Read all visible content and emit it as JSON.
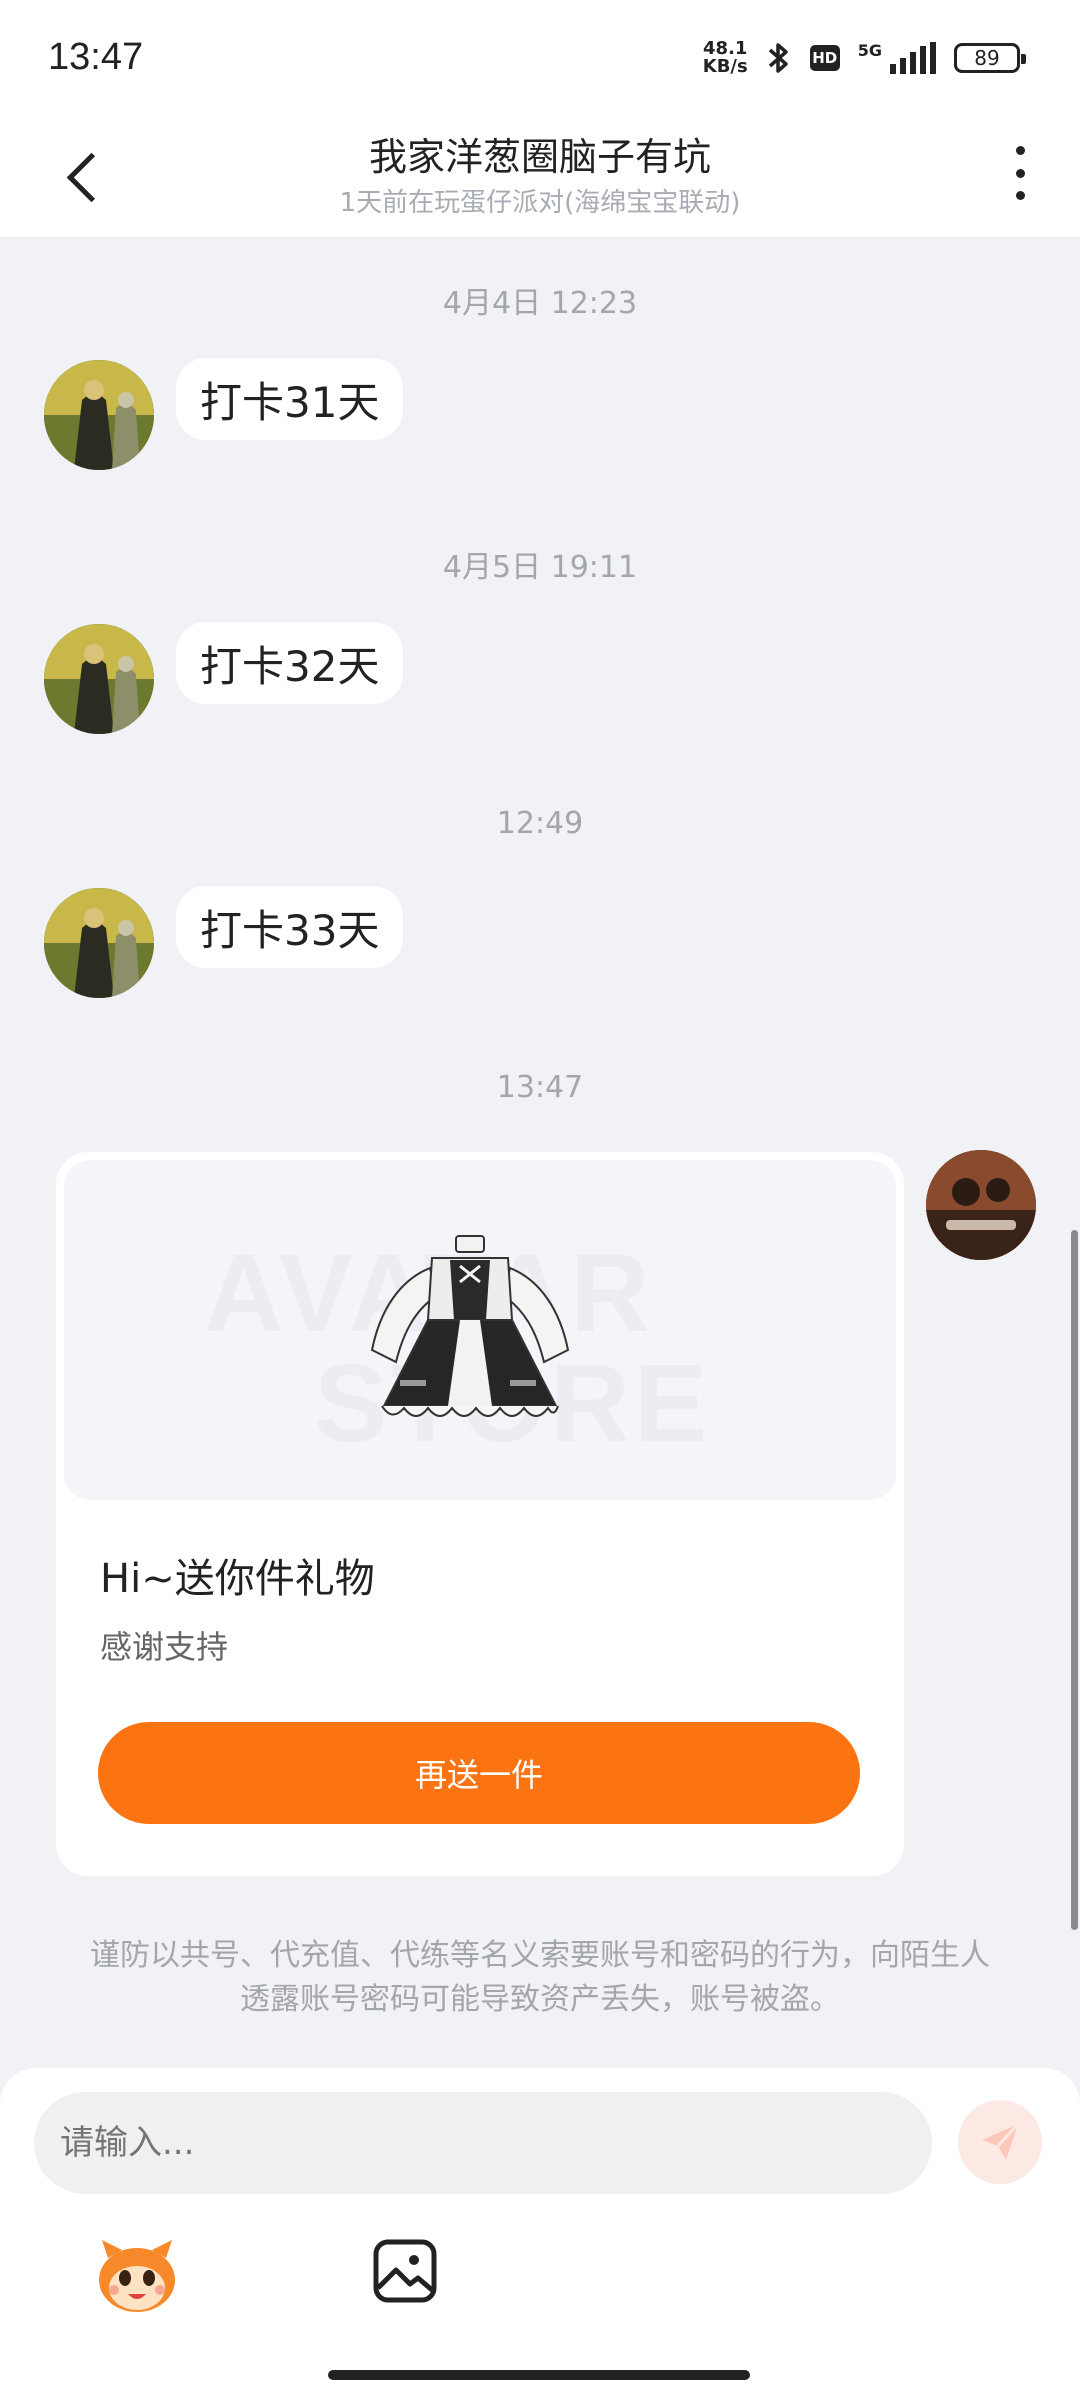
{
  "status_bar": {
    "time": "13:47",
    "net_speed_value": "48.1",
    "net_speed_unit": "KB/s",
    "hd_label": "HD",
    "network_label": "5G",
    "battery": "89"
  },
  "header": {
    "title": "我家洋葱圈脑子有坑",
    "subtitle": "1天前在玩蛋仔派对(海绵宝宝联动)"
  },
  "messages": [
    {
      "timestamp": "4月4日 12:23",
      "text": "打卡31天"
    },
    {
      "timestamp": "4月5日 19:11",
      "text": "打卡32天"
    },
    {
      "timestamp": "12:49",
      "text": "打卡33天"
    }
  ],
  "gift": {
    "timestamp": "13:47",
    "watermark_line1": "AVATAR",
    "watermark_line2": "STORE",
    "title": "Hi~送你件礼物",
    "subtitle": "感谢支持",
    "button_label": "再送一件"
  },
  "warning": "谨防以共号、代充值、代练等名义索要账号和密码的行为，向陌生人透露账号密码可能导致资产丢失，账号被盗。",
  "composer": {
    "placeholder": "请输入..."
  },
  "colors": {
    "accent": "#fc7312",
    "background": "#f1f2f6",
    "send_button_bg": "#fde9e4"
  }
}
